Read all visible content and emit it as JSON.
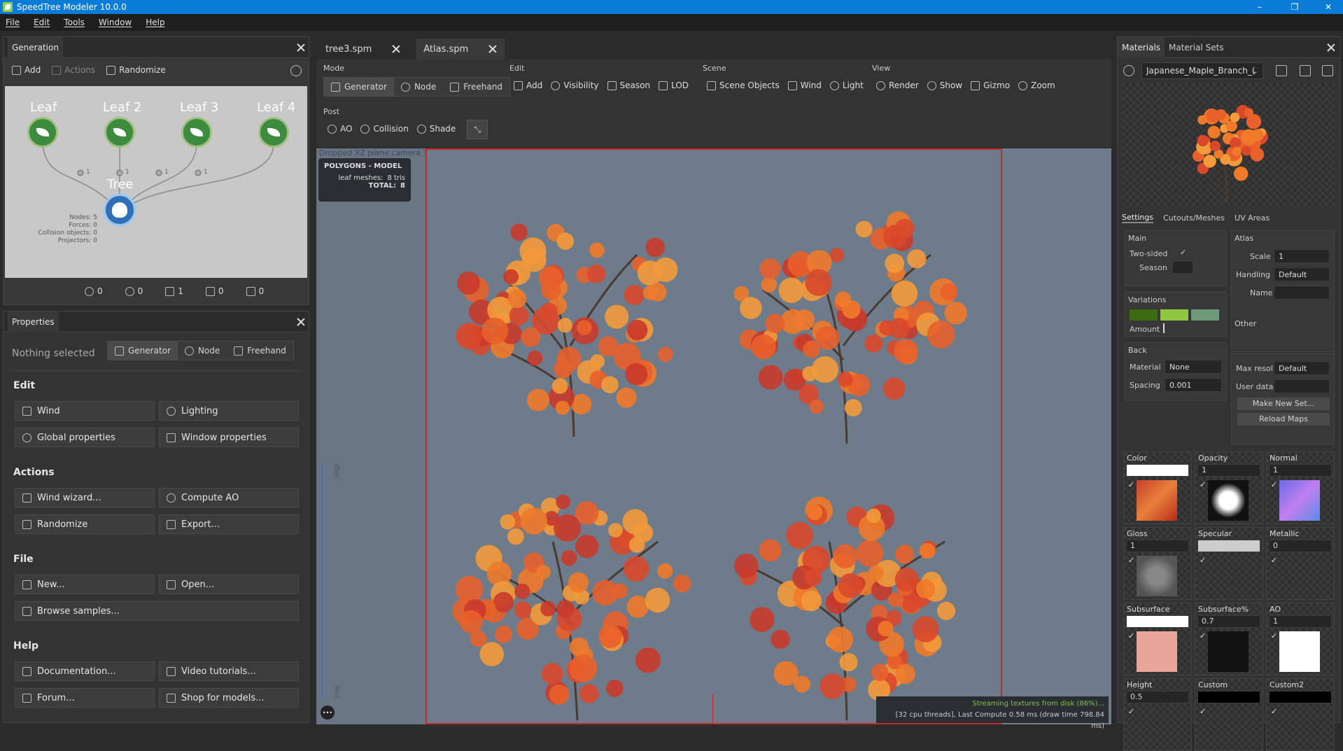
{
  "window": {
    "title": "SpeedTree Modeler 10.0.0",
    "min": "–",
    "max": "❐",
    "close": "✕"
  },
  "menu": [
    "File",
    "Edit",
    "Tools",
    "Window",
    "Help"
  ],
  "generation": {
    "tab": "Generation",
    "toolbar": {
      "add": "Add",
      "actions": "Actions",
      "randomize": "Randomize"
    },
    "nodes": [
      "Leaf",
      "Leaf 2",
      "Leaf 3",
      "Leaf 4"
    ],
    "edge_labels": [
      "1",
      "1",
      "1",
      "1"
    ],
    "tree_label": "Tree",
    "stats": [
      "Nodes: 5",
      "Forces: 0",
      "Collision objects: 0",
      "Projectors: 0"
    ],
    "counters": [
      "0",
      "0",
      "1",
      "0",
      "0"
    ]
  },
  "properties": {
    "tab": "Properties",
    "nothing_selected": "Nothing selected",
    "modes": [
      "Generator",
      "Node",
      "Freehand"
    ],
    "edit_title": "Edit",
    "edit": [
      "Wind",
      "Lighting",
      "Global properties",
      "Window properties"
    ],
    "actions_title": "Actions",
    "actions": [
      "Wind wizard...",
      "Compute AO",
      "Randomize",
      "Export..."
    ],
    "file_title": "File",
    "file": [
      "New...",
      "Open...",
      "Browse samples..."
    ],
    "help_title": "Help",
    "help": [
      "Documentation...",
      "Video tutorials...",
      "Forum...",
      "Shop for models..."
    ]
  },
  "doc_tabs": [
    "tree3.spm",
    "Atlas.spm"
  ],
  "toolbar": {
    "mode_title": "Mode",
    "modes": [
      "Generator",
      "Node",
      "Freehand"
    ],
    "edit_title": "Edit",
    "edit": [
      "Add",
      "Visibility",
      "Season",
      "LOD"
    ],
    "scene_title": "Scene",
    "scene": [
      "Scene Objects",
      "Wind",
      "Light"
    ],
    "view_title": "View",
    "view": [
      "Render",
      "Show",
      "Gizmo",
      "Zoom"
    ],
    "post_title": "Post",
    "post": [
      "AO",
      "Collision",
      "Shade"
    ]
  },
  "viewport": {
    "camera_label": "Dropped XZ plane camera 3",
    "poly_title": "POLYGONS - MODEL",
    "poly_rows": [
      {
        "k": "leaf meshes:",
        "v": "8 tris"
      },
      {
        "k": "TOTAL:",
        "v": "8"
      }
    ],
    "slider_high": "High",
    "slider_low": "Low",
    "status_stream": "Streaming textures from disk (86%)...",
    "status_compute": "[32 cpu threads], Last Compute 0.58 ms (draw time 798.84 ms)",
    "more": "•••"
  },
  "materials": {
    "tabs": [
      "Materials",
      "Material Sets"
    ],
    "selected": "Japanese_Maple_Branch_(",
    "subtabs": [
      "Settings",
      "Cutouts/Meshes",
      "UV Areas"
    ],
    "main_title": "Main",
    "two_sided": "Two-sided",
    "season": "Season",
    "check": "✓",
    "variations_title": "Variations",
    "variation_colors": [
      "#3a6b0e",
      "#8ec63f",
      "#6f9a7a"
    ],
    "amount": "Amount",
    "back_title": "Back",
    "material_lbl": "Material",
    "material_val": "None",
    "spacing_lbl": "Spacing",
    "spacing_val": "0.001",
    "atlas_title": "Atlas",
    "scale_lbl": "Scale",
    "scale_val": "1",
    "handling_lbl": "Handling",
    "handling_val": "Default",
    "name_lbl": "Name",
    "other_title": "Other",
    "maxres_lbl": "Max resol",
    "maxres_val": "Default",
    "userdata_lbl": "User data",
    "make_set": "Make New Set...",
    "reload": "Reload Maps",
    "cells": [
      {
        "t": "Color",
        "v": ""
      },
      {
        "t": "Opacity",
        "v": "1"
      },
      {
        "t": "Normal",
        "v": "1"
      },
      {
        "t": "Gloss",
        "v": "1"
      },
      {
        "t": "Specular",
        "v": ""
      },
      {
        "t": "Metallic",
        "v": "0"
      },
      {
        "t": "Subsurface",
        "v": ""
      },
      {
        "t": "Subsurface%",
        "v": "0.7"
      },
      {
        "t": "AO",
        "v": "1"
      },
      {
        "t": "Height",
        "v": "0.5"
      },
      {
        "t": "Custom",
        "v": ""
      },
      {
        "t": "Custom2",
        "v": ""
      }
    ]
  }
}
